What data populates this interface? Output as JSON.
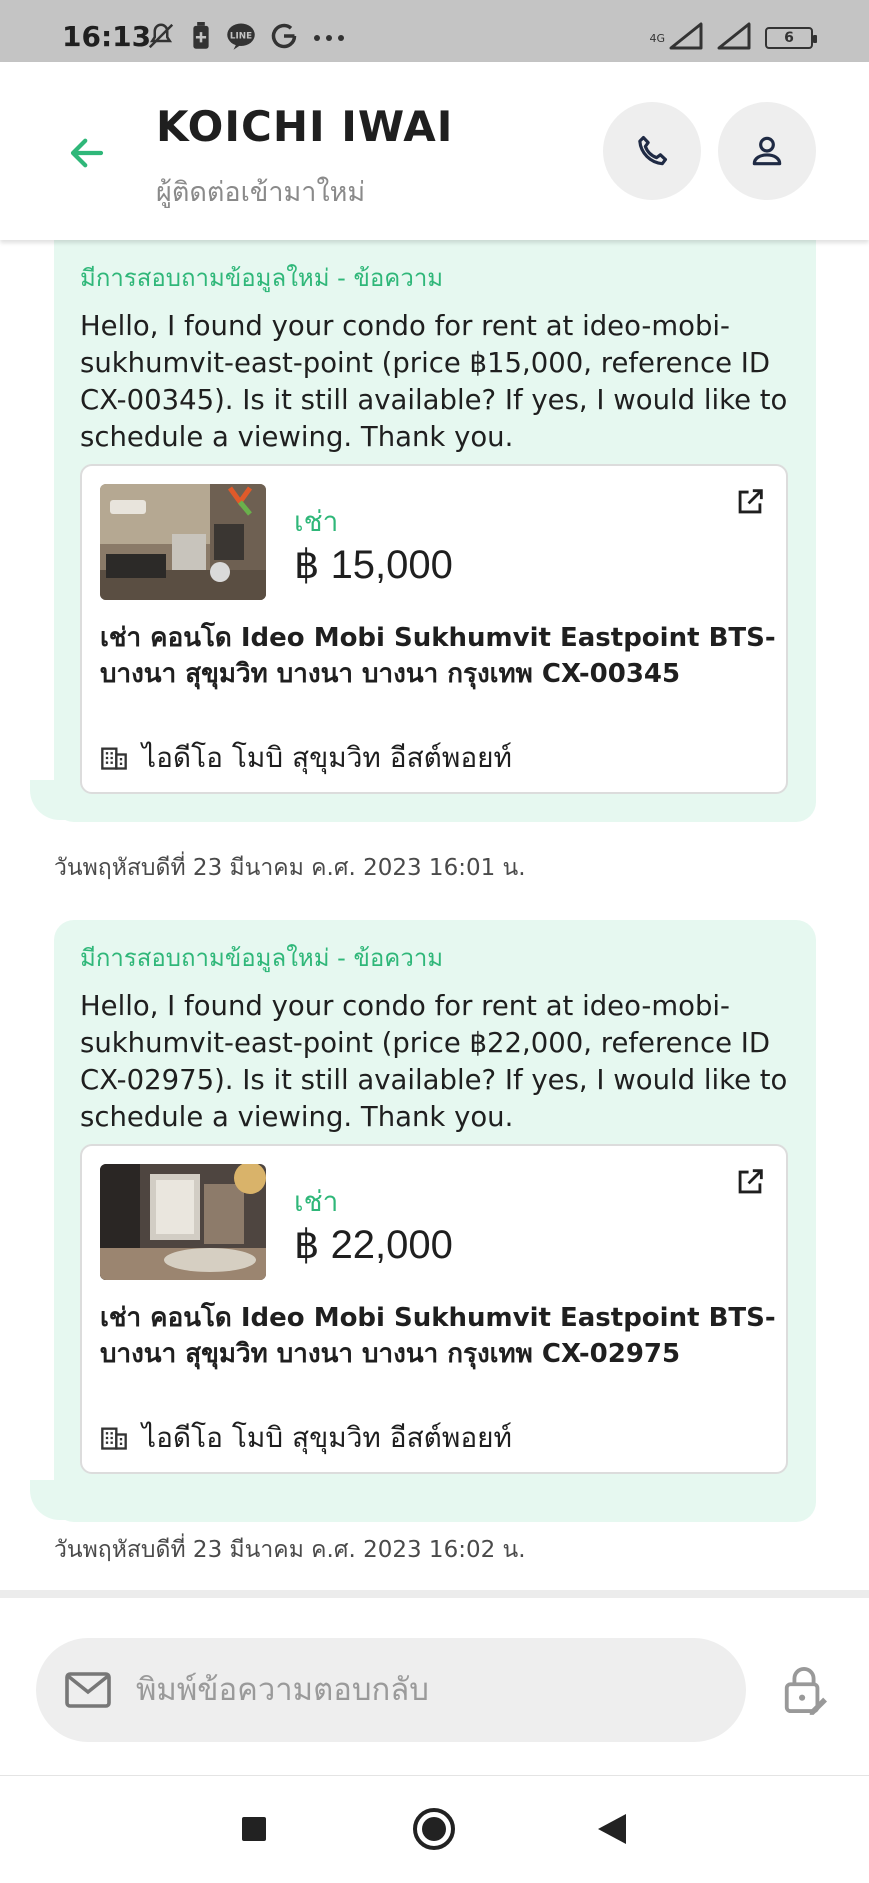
{
  "status_bar": {
    "time": "16:13",
    "network": "4G",
    "battery": "6",
    "app_icons": [
      "mute-icon",
      "battery-saver-icon",
      "line-icon",
      "google-icon",
      "more-dots-icon"
    ]
  },
  "header": {
    "name": "KOICHI IWAI",
    "subtitle": "ผู้ติดต่อเข้ามาใหม่"
  },
  "messages": [
    {
      "label": "มีการสอบถามข้อมูลใหม่ - ข้อความ",
      "text": "Hello, I found your condo for rent at ideo-mobi-sukhumvit-east-point (price ฿15,000, reference ID CX-00345). Is it still available? If yes, I would like to schedule a viewing. Thank you.",
      "listing": {
        "type": "เช่า",
        "price": "฿ 15,000",
        "title": "เช่า คอนโด  Ideo Mobi Sukhumvit Eastpoint BTS-บางนา สุขุมวิท บางนา บางนา กรุงเทพ CX-00345",
        "project": "ไอดีโอ โมบิ สุขุมวิท อีสต์พอยท์"
      },
      "timestamp": "วันพฤหัสบดีที่ 23 มีนาคม ค.ศ. 2023 16:01 น."
    },
    {
      "label": "มีการสอบถามข้อมูลใหม่ - ข้อความ",
      "text": "Hello, I found your condo for rent at ideo-mobi-sukhumvit-east-point (price ฿22,000, reference ID CX-02975). Is it still available? If yes, I would like to schedule a viewing. Thank you.",
      "listing": {
        "type": "เช่า",
        "price": "฿ 22,000",
        "title": "เช่า คอนโด  Ideo Mobi Sukhumvit Eastpoint BTS-บางนา สุขุมวิท บางนา บางนา กรุงเทพ CX-02975",
        "project": "ไอดีโอ โมบิ สุขุมวิท อีสต์พอยท์"
      },
      "timestamp": "วันพฤหัสบดีที่ 23 มีนาคม ค.ศ. 2023 16:02 น."
    }
  ],
  "reply": {
    "placeholder": "พิมพ์ข้อความตอบกลับ"
  },
  "colors": {
    "accent": "#2fb779",
    "bubble": "#e6f8f0",
    "status_bar": "#c4c4c4"
  }
}
